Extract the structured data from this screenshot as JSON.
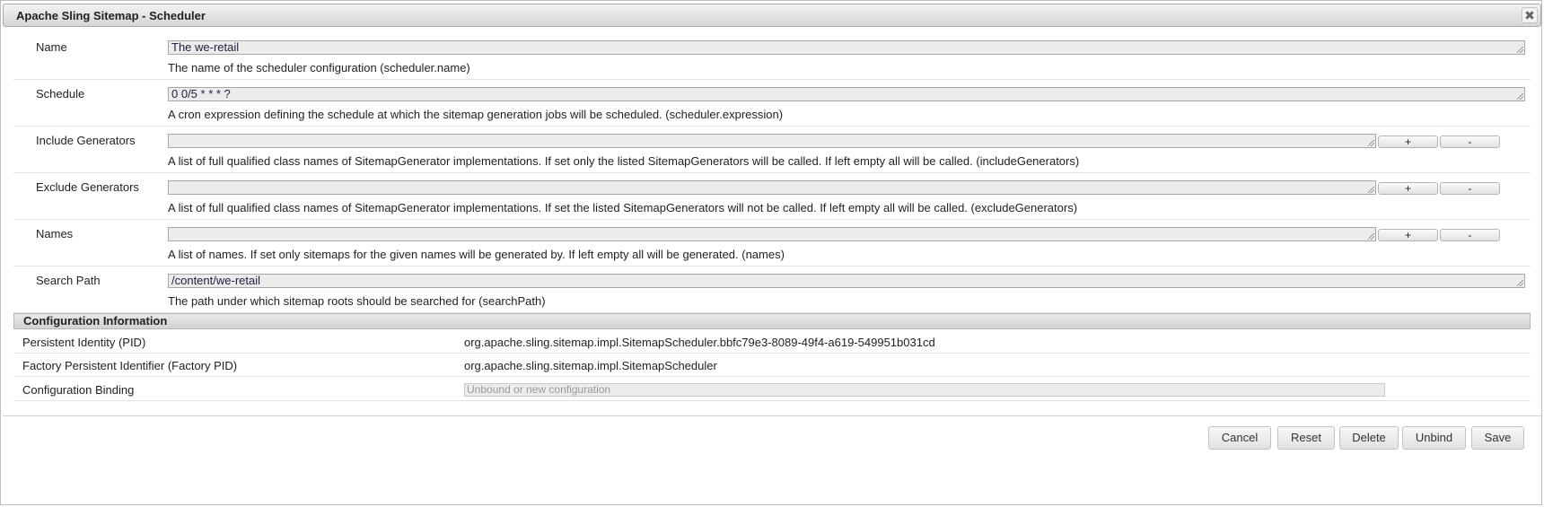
{
  "dialog": {
    "title": "Apache Sling Sitemap - Scheduler",
    "close_icon": "close-icon"
  },
  "fields": [
    {
      "label": "Name",
      "value": "The we-retail",
      "description": "The name of the scheduler configuration (scheduler.name)"
    },
    {
      "label": "Schedule",
      "value": "0 0/5 * * * ?",
      "description": "A cron expression defining the schedule at which the sitemap generation jobs will be scheduled. (scheduler.expression)"
    },
    {
      "label": "Include Generators",
      "value": "",
      "add_label": "+",
      "remove_label": "-",
      "description": "A list of full qualified class names of SitemapGenerator implementations. If set only the listed SitemapGenerators will be called. If left empty all will be called. (includeGenerators)"
    },
    {
      "label": "Exclude Generators",
      "value": "",
      "add_label": "+",
      "remove_label": "-",
      "description": "A list of full qualified class names of SitemapGenerator implementations. If set the listed SitemapGenerators will not be called. If left empty all will be called. (excludeGenerators)"
    },
    {
      "label": "Names",
      "value": "",
      "add_label": "+",
      "remove_label": "-",
      "description": "A list of names. If set only sitemaps for the given names will be generated by. If left empty all will be generated. (names)"
    },
    {
      "label": "Search Path",
      "value": "/content/we-retail",
      "description": "The path under which sitemap roots should be searched for (searchPath)"
    }
  ],
  "config_info": {
    "header": "Configuration Information",
    "pid_label": "Persistent Identity (PID)",
    "pid_value": "org.apache.sling.sitemap.impl.SitemapScheduler.bbfc79e3-8089-49f4-a619-549951b031cd",
    "factory_pid_label": "Factory Persistent Identifier (Factory PID)",
    "factory_pid_value": "org.apache.sling.sitemap.impl.SitemapScheduler",
    "binding_label": "Configuration Binding",
    "binding_placeholder": "Unbound or new configuration"
  },
  "buttons": {
    "cancel": "Cancel",
    "reset": "Reset",
    "delete": "Delete",
    "unbind": "Unbind",
    "save": "Save"
  }
}
